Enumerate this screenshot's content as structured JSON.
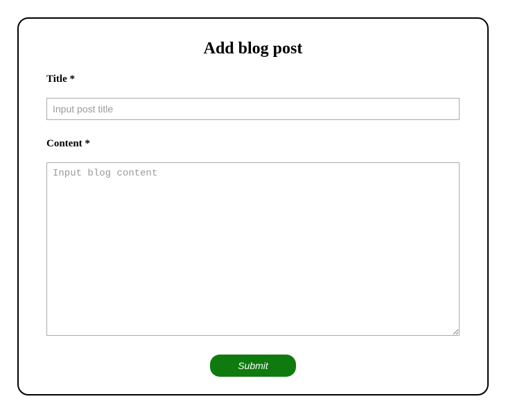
{
  "form": {
    "heading": "Add blog post",
    "title_label": "Title *",
    "title_placeholder": "Input post title",
    "title_value": "",
    "content_label": "Content *",
    "content_placeholder": "Input blog content",
    "content_value": "",
    "submit_label": "Submit"
  }
}
